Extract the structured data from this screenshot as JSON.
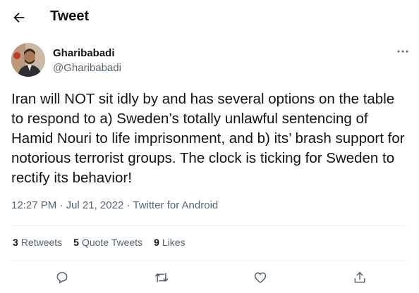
{
  "header": {
    "title": "Tweet",
    "back_icon": "arrow-left-icon"
  },
  "author": {
    "name": "Gharibabadi",
    "handle": "@Gharibabadi"
  },
  "tweet": {
    "text": "Iran will NOT sit idly by and has several options on the table to respond to a) Sweden’s totally unlawful sentencing of Hamid Nouri to life imprisonment, and b) its’ brash support for notorious terrorist groups. The clock is ticking for Sweden to rectify its behavior!"
  },
  "meta": {
    "time": "12:27 PM",
    "separator": " · ",
    "date": "Jul 21, 2022",
    "source": "Twitter for Android"
  },
  "stats": {
    "retweets": {
      "count": "3",
      "label": "Retweets"
    },
    "quote_tweets": {
      "count": "5",
      "label": "Quote Tweets"
    },
    "likes": {
      "count": "9",
      "label": "Likes"
    }
  },
  "actions": [
    "reply-icon",
    "retweet-icon",
    "like-icon",
    "share-icon"
  ],
  "colors": {
    "text": "#0f1419",
    "secondary": "#536471",
    "divider": "#eff3f4",
    "background": "#ffffff"
  }
}
